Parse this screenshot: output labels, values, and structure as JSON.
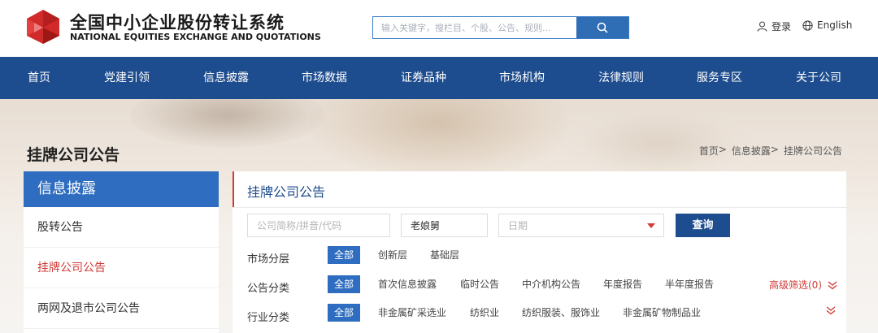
{
  "header": {
    "brand_cn": "全国中小企业股份转让系统",
    "brand_en": "NATIONAL EQUITIES EXCHANGE AND QUOTATIONS",
    "search_placeholder": "输入关键字，搜栏目、个股、公告、规则...",
    "login_label": "登录",
    "english_label": "English"
  },
  "nav": {
    "items": [
      "首页",
      "党建引领",
      "信息披露",
      "市场数据",
      "证券品种",
      "市场机构",
      "法律规则",
      "服务专区",
      "关于公司"
    ]
  },
  "page": {
    "title": "挂牌公司公告",
    "breadcrumb": [
      "首页",
      "信息披露",
      "挂牌公司公告"
    ],
    "breadcrumb_separator": ">"
  },
  "sidebar": {
    "header": "信息披露",
    "items": [
      {
        "label": "股转公告",
        "active": false
      },
      {
        "label": "挂牌公司公告",
        "active": true
      },
      {
        "label": "两网及退市公司公告",
        "active": false
      }
    ]
  },
  "content": {
    "title": "挂牌公司公告",
    "company_placeholder": "公司简称/拼音/代码",
    "keyword_value": "老娘舅",
    "date_placeholder": "日期",
    "query_label": "查询",
    "filters": {
      "market_tier": {
        "label": "市场分层",
        "options": [
          "全部",
          "创新层",
          "基础层"
        ],
        "selected": "全部"
      },
      "announcement_type": {
        "label": "公告分类",
        "options": [
          "全部",
          "首次信息披露",
          "临时公告",
          "中介机构公告",
          "年度报告",
          "半年度报告"
        ],
        "selected": "全部"
      },
      "industry": {
        "label": "行业分类",
        "options": [
          "全部",
          "非金属矿采选业",
          "纺织业",
          "纺织服装、服饰业",
          "非金属矿物制品业"
        ],
        "selected": "全部"
      }
    },
    "advanced_filter_label": "高级筛选(0)"
  },
  "colors": {
    "nav_bg": "#1e4d8f",
    "accent_blue": "#2e6dbf",
    "accent_red": "#d13a36"
  },
  "icons": [
    "logo-icon",
    "search-icon",
    "user-icon",
    "globe-icon",
    "caret-down-icon",
    "double-chevron-down-icon"
  ]
}
